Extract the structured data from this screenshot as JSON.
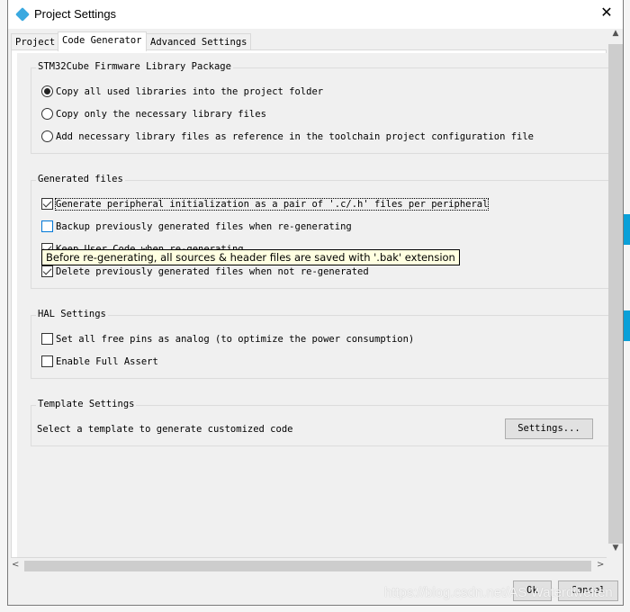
{
  "window": {
    "title": "Project Settings",
    "close": "✕"
  },
  "tabs": [
    {
      "label": "Project"
    },
    {
      "label": "Code Generator"
    },
    {
      "label": "Advanced Settings"
    }
  ],
  "firmware": {
    "title": "STM32Cube Firmware Library Package",
    "options": [
      {
        "label": "Copy all used libraries into the project folder",
        "selected": true
      },
      {
        "label": "Copy only the necessary library files",
        "selected": false
      },
      {
        "label": "Add necessary library files as reference in the toolchain project configuration file",
        "selected": false
      }
    ]
  },
  "generated": {
    "title": "Generated files",
    "options": [
      {
        "label": "Generate peripheral initialization as a pair of '.c/.h' files per peripheral",
        "checked": true
      },
      {
        "label": "Backup previously generated files when re-generating",
        "checked": false
      },
      {
        "label": "Keep User Code when re-generating",
        "checked": true
      },
      {
        "label": "Delete previously generated files when not re-generated",
        "checked": true
      }
    ]
  },
  "tooltip": "Before re-generating, all sources & header files are saved with '.bak' extension",
  "hal": {
    "title": "HAL Settings",
    "options": [
      {
        "label": "Set all free pins as analog (to optimize the power consumption)",
        "checked": false
      },
      {
        "label": "Enable Full Assert",
        "checked": false
      }
    ]
  },
  "template": {
    "title": "Template Settings",
    "text": "Select a template to generate customized code",
    "button": "Settings..."
  },
  "footer": {
    "ok": "Ok",
    "cancel": "Cancel"
  },
  "watermark": "https://blog.csdn.net/AS Waterdwelten",
  "scroll": {
    "up": "▲",
    "down": "▼",
    "left": "<",
    "right": ">"
  }
}
